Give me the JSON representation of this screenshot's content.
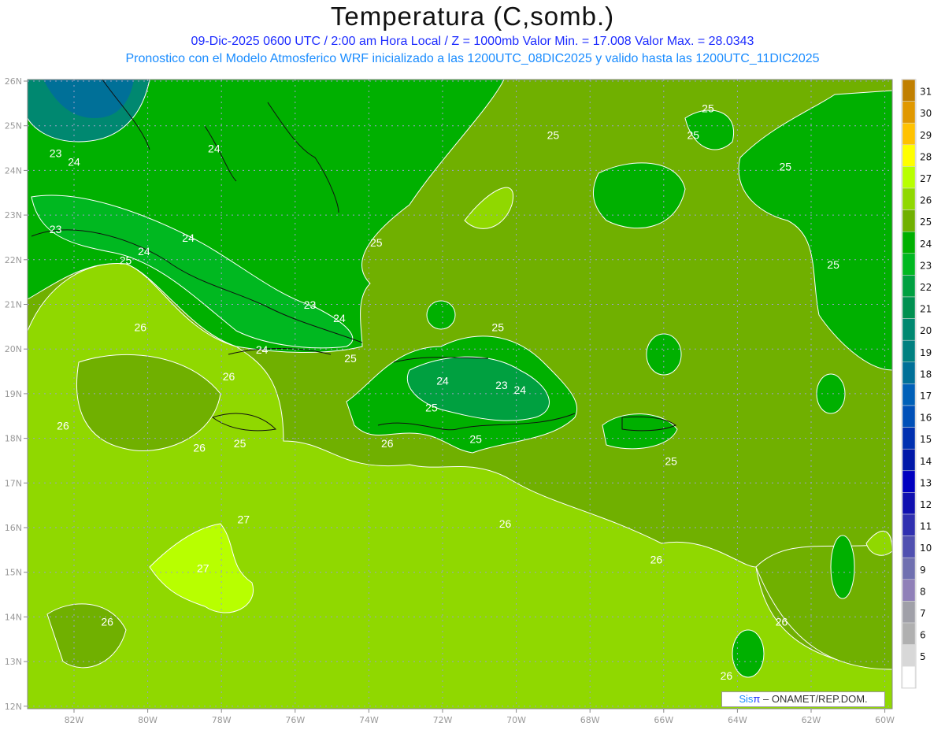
{
  "header": {
    "title": "Temperatura (C,somb.)",
    "line1": "09-Dic-2025  0600 UTC / 2:00 am Hora Local / Z = 1000mb    Valor Min. = 17.008  Valor Max. = 28.0343",
    "line2": "Pronostico con el Modelo Atmosferico WRF inicializado a las 1200UTC_08DIC2025 y valido hasta las  1200UTC_11DIC2025"
  },
  "map": {
    "lon_labels": [
      "82W",
      "80W",
      "78W",
      "76W",
      "74W",
      "72W",
      "70W",
      "68W",
      "66W",
      "64W",
      "62W",
      "60W"
    ],
    "lon_values": [
      -82,
      -80,
      -78,
      -76,
      -74,
      -72,
      -70,
      -68,
      -66,
      -64,
      -62,
      -60
    ],
    "lat_labels": [
      "26N",
      "25N",
      "24N",
      "23N",
      "22N",
      "21N",
      "20N",
      "19N",
      "18N",
      "17N",
      "16N",
      "15N",
      "14N",
      "13N",
      "12N"
    ],
    "lat_values": [
      26,
      25,
      24,
      23,
      22,
      21,
      20,
      19,
      18,
      17,
      16,
      15,
      14,
      13,
      12
    ],
    "contour_labels": [
      {
        "text": "23",
        "lon": -82.5,
        "lat": 24.3
      },
      {
        "text": "24",
        "lon": -82.0,
        "lat": 24.1
      },
      {
        "text": "24",
        "lon": -78.2,
        "lat": 24.4
      },
      {
        "text": "23",
        "lon": -82.5,
        "lat": 22.6
      },
      {
        "text": "24",
        "lon": -80.1,
        "lat": 22.1
      },
      {
        "text": "24",
        "lon": -78.9,
        "lat": 22.4
      },
      {
        "text": "25",
        "lon": -80.6,
        "lat": 21.9
      },
      {
        "text": "25",
        "lon": -73.8,
        "lat": 22.3
      },
      {
        "text": "23",
        "lon": -75.6,
        "lat": 20.9
      },
      {
        "text": "24",
        "lon": -74.8,
        "lat": 20.6
      },
      {
        "text": "24",
        "lon": -76.9,
        "lat": 19.9
      },
      {
        "text": "25",
        "lon": -74.5,
        "lat": 19.7
      },
      {
        "text": "26",
        "lon": -80.2,
        "lat": 20.4
      },
      {
        "text": "26",
        "lon": -77.8,
        "lat": 19.3
      },
      {
        "text": "26",
        "lon": -82.3,
        "lat": 18.2
      },
      {
        "text": "26",
        "lon": -78.6,
        "lat": 17.7
      },
      {
        "text": "25",
        "lon": -77.5,
        "lat": 17.8
      },
      {
        "text": "26",
        "lon": -73.5,
        "lat": 17.8
      },
      {
        "text": "25",
        "lon": -72.3,
        "lat": 18.6
      },
      {
        "text": "24",
        "lon": -72.0,
        "lat": 19.2
      },
      {
        "text": "23",
        "lon": -70.4,
        "lat": 19.1
      },
      {
        "text": "24",
        "lon": -69.9,
        "lat": 19.0
      },
      {
        "text": "25",
        "lon": -71.1,
        "lat": 17.9
      },
      {
        "text": "25",
        "lon": -70.5,
        "lat": 20.4
      },
      {
        "text": "25",
        "lon": -65.8,
        "lat": 17.4
      },
      {
        "text": "25",
        "lon": -69.0,
        "lat": 24.7
      },
      {
        "text": "25",
        "lon": -64.8,
        "lat": 25.3
      },
      {
        "text": "25",
        "lon": -65.2,
        "lat": 24.7
      },
      {
        "text": "25",
        "lon": -62.7,
        "lat": 24.0
      },
      {
        "text": "25",
        "lon": -61.4,
        "lat": 21.8
      },
      {
        "text": "26",
        "lon": -70.3,
        "lat": 16.0
      },
      {
        "text": "26",
        "lon": -66.2,
        "lat": 15.2
      },
      {
        "text": "26",
        "lon": -62.8,
        "lat": 13.8
      },
      {
        "text": "26",
        "lon": -64.3,
        "lat": 12.6
      },
      {
        "text": "27",
        "lon": -77.4,
        "lat": 16.1
      },
      {
        "text": "27",
        "lon": -78.5,
        "lat": 15.0
      },
      {
        "text": "26",
        "lon": -81.1,
        "lat": 13.8
      }
    ]
  },
  "colorbar": {
    "labels": [
      "31",
      "30",
      "29",
      "28",
      "27",
      "26",
      "25",
      "24",
      "23",
      "22",
      "21",
      "20",
      "19",
      "18",
      "17",
      "16",
      "15",
      "14",
      "13",
      "12",
      "11",
      "10",
      "9",
      "8",
      "7",
      "6",
      "5"
    ],
    "colors": [
      "#c07f00",
      "#e09800",
      "#ffc200",
      "#ffff00",
      "#b8ff00",
      "#90d800",
      "#70b000",
      "#00b000",
      "#00b820",
      "#00a040",
      "#009050",
      "#008870",
      "#008080",
      "#007098",
      "#0060b8",
      "#0050b8",
      "#0030b0",
      "#0018a8",
      "#0000c0",
      "#1010b0",
      "#3030b0",
      "#5050b0",
      "#7070b0",
      "#9080b8",
      "#a0a0a8",
      "#b0b0b0",
      "#d8d8d8",
      "#ffffff"
    ]
  },
  "credit": {
    "sis": "Sis",
    "pi": "π",
    "rest": " – ONAMET/REP.DOM."
  }
}
